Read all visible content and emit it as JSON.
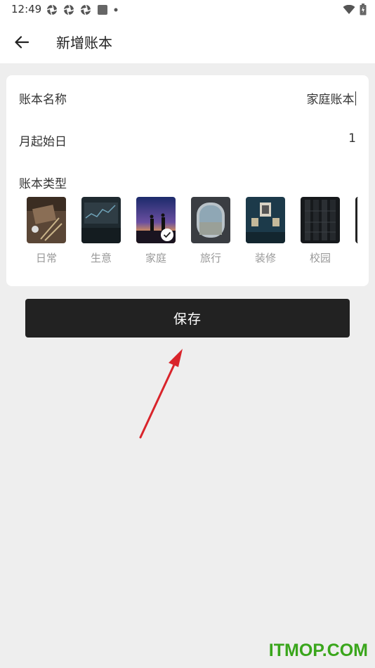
{
  "status_bar": {
    "time": "12:49"
  },
  "header": {
    "title": "新增账本"
  },
  "form": {
    "name_label": "账本名称",
    "name_value": "家庭账本",
    "start_day_label": "月起始日",
    "start_day_value": "1",
    "type_label": "账本类型"
  },
  "book_types": [
    {
      "label": "日常",
      "selected": false
    },
    {
      "label": "生意",
      "selected": false
    },
    {
      "label": "家庭",
      "selected": true
    },
    {
      "label": "旅行",
      "selected": false
    },
    {
      "label": "装修",
      "selected": false
    },
    {
      "label": "校园",
      "selected": false
    }
  ],
  "actions": {
    "save_label": "保存"
  },
  "watermark": "ITMOP.COM",
  "colors": {
    "accent": "#222222",
    "background": "#eeeeee",
    "arrow": "#d9242b",
    "watermark": "#3aa61c"
  }
}
